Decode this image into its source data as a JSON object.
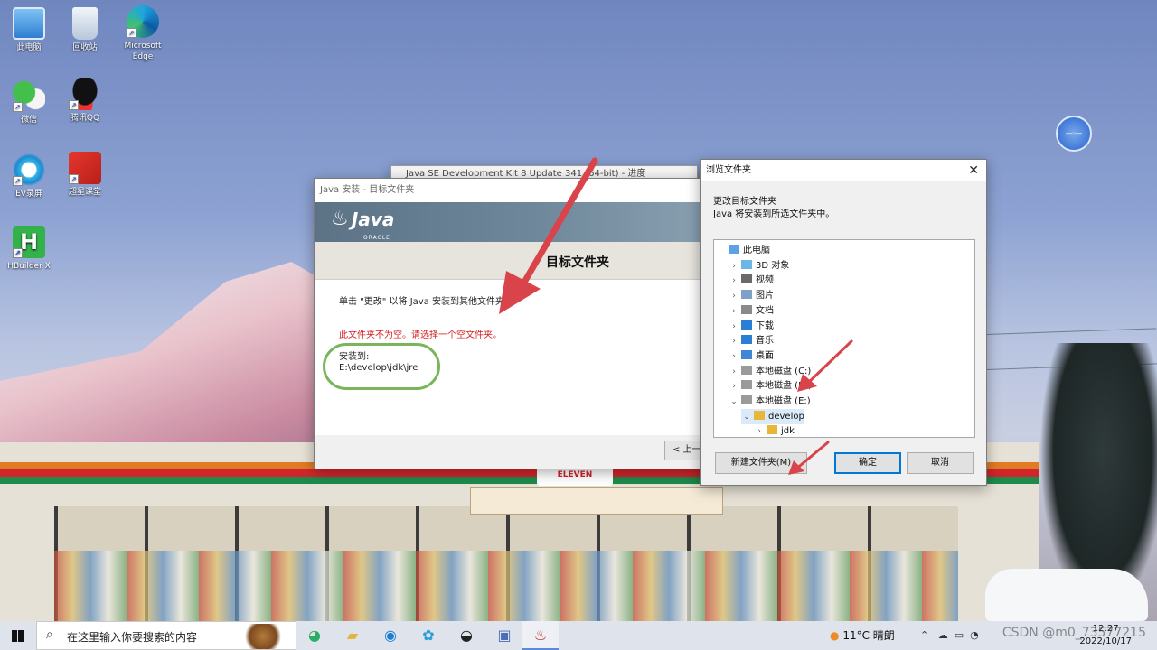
{
  "desktop": {
    "icons": [
      {
        "label": "此电脑",
        "icon": "computer-icon"
      },
      {
        "label": "回收站",
        "icon": "recycle-bin-icon"
      },
      {
        "label": "Microsoft Edge",
        "icon": "edge-icon"
      },
      {
        "label": "微信",
        "icon": "wechat-icon"
      },
      {
        "label": "腾讯QQ",
        "icon": "qq-icon"
      },
      {
        "label": "EV录屏",
        "icon": "ev-recorder-icon"
      },
      {
        "label": "超星课堂",
        "icon": "chaoxing-icon"
      },
      {
        "label": "HBuilder X",
        "icon": "hbuilder-icon"
      }
    ],
    "store_sign": "ELEVEN"
  },
  "java_back_window": {
    "title": "Java SE Development Kit 8 Update 341 (64-bit) - 进度"
  },
  "java_installer": {
    "title": "Java 安装 - 目标文件夹",
    "logo_word": "Java",
    "logo_sub": "ORACLE",
    "heading": "目标文件夹",
    "description": "单击 \"更改\" 以将 Java 安装到其他文件夹。",
    "error": "此文件夹不为空。请选择一个空文件夹。",
    "install_label": "安装到:",
    "install_path": "E:\\develop\\jdk\\jre",
    "back_button": "< 上一步"
  },
  "browse_dialog": {
    "title": "浏览文件夹",
    "subtitle1": "更改目标文件夹",
    "subtitle2": "Java 将安装到所选文件夹中。",
    "tree": [
      {
        "label": "此电脑",
        "depth": 0,
        "chevron": "",
        "icon": "computer-icon"
      },
      {
        "label": "3D 对象",
        "depth": 1,
        "chevron": "›",
        "icon": "3d-objects-icon"
      },
      {
        "label": "视频",
        "depth": 1,
        "chevron": "›",
        "icon": "videos-icon"
      },
      {
        "label": "图片",
        "depth": 1,
        "chevron": "›",
        "icon": "pictures-icon"
      },
      {
        "label": "文档",
        "depth": 1,
        "chevron": "›",
        "icon": "documents-icon"
      },
      {
        "label": "下载",
        "depth": 1,
        "chevron": "›",
        "icon": "downloads-icon"
      },
      {
        "label": "音乐",
        "depth": 1,
        "chevron": "›",
        "icon": "music-icon"
      },
      {
        "label": "桌面",
        "depth": 1,
        "chevron": "›",
        "icon": "desktop-folder-icon"
      },
      {
        "label": "本地磁盘 (C:)",
        "depth": 1,
        "chevron": "›",
        "icon": "drive-icon"
      },
      {
        "label": "本地磁盘 (D:)",
        "depth": 1,
        "chevron": "›",
        "icon": "drive-icon"
      },
      {
        "label": "本地磁盘 (E:)",
        "depth": 1,
        "chevron": "⌄",
        "icon": "drive-icon"
      },
      {
        "label": "develop",
        "depth": 2,
        "chevron": "⌄",
        "icon": "folder-icon",
        "selected": true
      },
      {
        "label": "jdk",
        "depth": 3,
        "chevron": "›",
        "icon": "folder-icon"
      }
    ],
    "new_folder_button": "新建文件夹(M)",
    "ok_button": "确定",
    "cancel_button": "取消"
  },
  "taskbar": {
    "search_placeholder": "在这里输入你要搜索的内容",
    "weather": "11°C  晴朗",
    "time": "12:27",
    "date": "2022/10/17",
    "watermark": "CSDN @m0_73577215"
  },
  "colors": {
    "error_red": "#d42020",
    "accent_blue": "#0078d7",
    "annotation_red": "#d9434a",
    "annotation_green": "#7ab55c"
  }
}
